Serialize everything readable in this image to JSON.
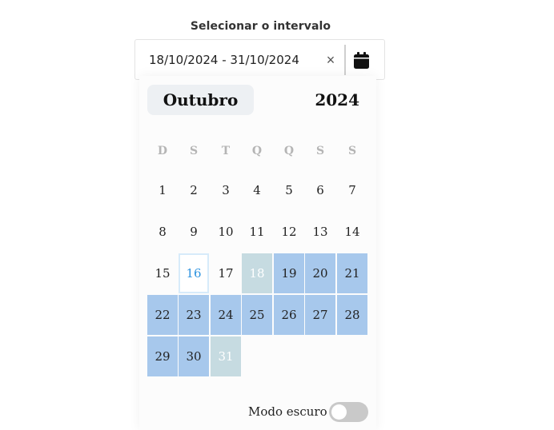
{
  "picker": {
    "label": "Selecionar o intervalo",
    "value": "18/10/2024 - 31/10/2024",
    "clear_icon": "×"
  },
  "calendar": {
    "month": "Outubro",
    "year": "2024",
    "weekdays": [
      "D",
      "S",
      "T",
      "Q",
      "Q",
      "S",
      "S"
    ],
    "today": "16",
    "range_start": "18",
    "range_end": "31",
    "weeks": [
      [
        "1",
        "2",
        "3",
        "4",
        "5",
        "6",
        "7"
      ],
      [
        "8",
        "9",
        "10",
        "11",
        "12",
        "13",
        "14"
      ],
      [
        "15",
        "16",
        "17",
        "18",
        "19",
        "20",
        "21"
      ],
      [
        "22",
        "23",
        "24",
        "25",
        "26",
        "27",
        "28"
      ],
      [
        "29",
        "30",
        "31"
      ]
    ]
  },
  "settings": {
    "dark_mode_label": "Modo escuro",
    "dark_mode_on": false
  },
  "colors": {
    "in_range": "#a7c8ec",
    "endpoint": "#c6dbe1",
    "today": "#2d93df"
  }
}
